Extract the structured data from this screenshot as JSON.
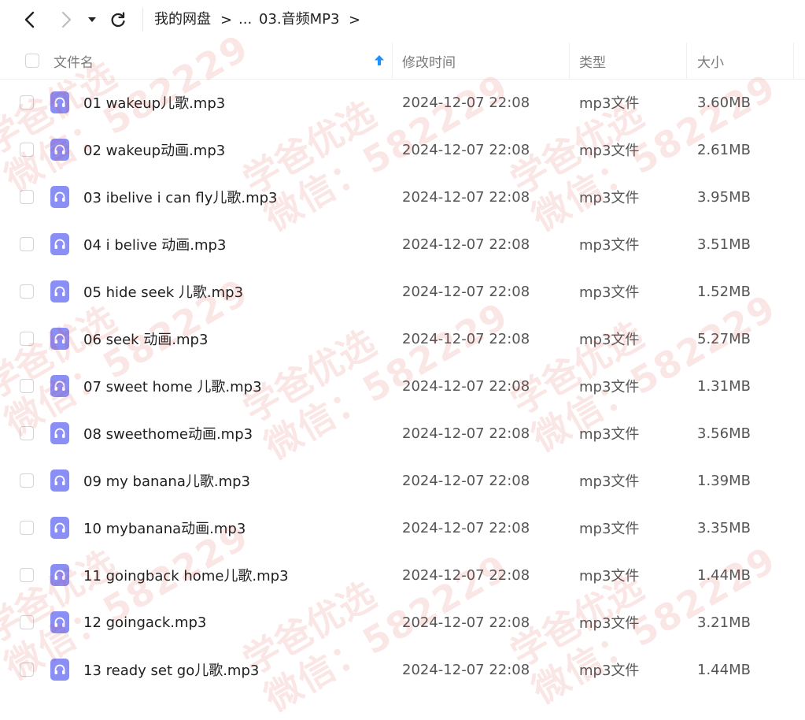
{
  "nav": {
    "back_icon": "chevron-left-icon",
    "forward_icon": "chevron-right-icon",
    "dropdown_icon": "caret-down-icon",
    "refresh_icon": "refresh-icon"
  },
  "breadcrumb": {
    "root": "我的网盘",
    "ellipsis": "...",
    "current": "03.音频MP3",
    "separator": ">"
  },
  "table": {
    "headers": {
      "name": "文件名",
      "modified": "修改时间",
      "type": "类型",
      "size": "大小"
    },
    "sort_icon": "sort-ascending-icon",
    "rows": [
      {
        "name": "01 wakeup儿歌.mp3",
        "modified": "2024-12-07 22:08",
        "type": "mp3文件",
        "size": "3.60MB"
      },
      {
        "name": "02 wakeup动画.mp3",
        "modified": "2024-12-07 22:08",
        "type": "mp3文件",
        "size": "2.61MB"
      },
      {
        "name": "03 ibelive i can fly儿歌.mp3",
        "modified": "2024-12-07 22:08",
        "type": "mp3文件",
        "size": "3.95MB"
      },
      {
        "name": "04 i belive 动画.mp3",
        "modified": "2024-12-07 22:08",
        "type": "mp3文件",
        "size": "3.51MB"
      },
      {
        "name": "05 hide seek 儿歌.mp3",
        "modified": "2024-12-07 22:08",
        "type": "mp3文件",
        "size": "1.52MB"
      },
      {
        "name": "06 seek 动画.mp3",
        "modified": "2024-12-07 22:08",
        "type": "mp3文件",
        "size": "5.27MB"
      },
      {
        "name": "07 sweet home 儿歌.mp3",
        "modified": "2024-12-07 22:08",
        "type": "mp3文件",
        "size": "1.31MB"
      },
      {
        "name": "08 sweethome动画.mp3",
        "modified": "2024-12-07 22:08",
        "type": "mp3文件",
        "size": "3.56MB"
      },
      {
        "name": "09 my banana儿歌.mp3",
        "modified": "2024-12-07 22:08",
        "type": "mp3文件",
        "size": "1.39MB"
      },
      {
        "name": "10 mybanana动画.mp3",
        "modified": "2024-12-07 22:08",
        "type": "mp3文件",
        "size": "3.35MB"
      },
      {
        "name": "11 goingback home儿歌.mp3",
        "modified": "2024-12-07 22:08",
        "type": "mp3文件",
        "size": "1.44MB"
      },
      {
        "name": "12 goingack.mp3",
        "modified": "2024-12-07 22:08",
        "type": "mp3文件",
        "size": "3.21MB"
      },
      {
        "name": "13 ready set go儿歌.mp3",
        "modified": "2024-12-07 22:08",
        "type": "mp3文件",
        "size": "1.44MB"
      }
    ]
  },
  "watermark": {
    "text": "学爸优选",
    "contact": "微信：582229"
  },
  "colors": {
    "file_icon": "#8a8ff5",
    "sort_icon": "#1e90ff",
    "watermark": "#dc3232"
  }
}
